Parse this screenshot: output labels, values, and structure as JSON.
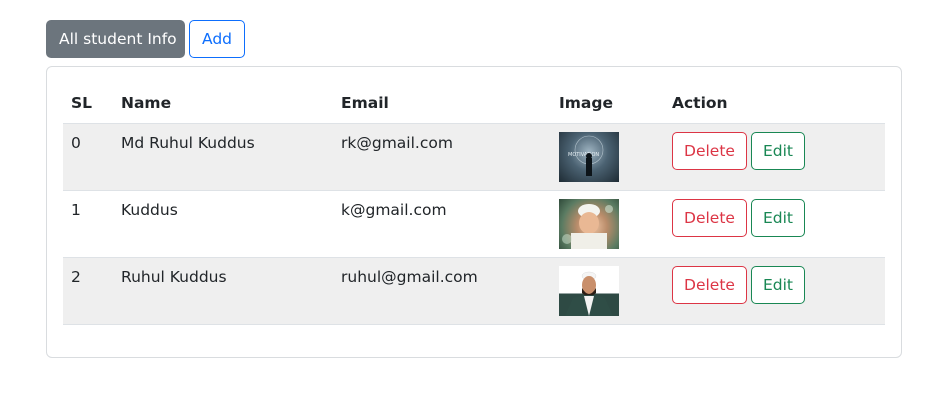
{
  "nav": {
    "all_label": "All student Info",
    "add_label": "Add"
  },
  "table": {
    "headers": {
      "sl": "SL",
      "name": "Name",
      "email": "Email",
      "image": "Image",
      "action": "Action"
    },
    "rows": [
      {
        "sl": "0",
        "name": "Md Ruhul Kuddus",
        "email": "rk@gmail.com",
        "image": "photo-person-silhouette",
        "delete_label": "Delete",
        "edit_label": "Edit"
      },
      {
        "sl": "1",
        "name": "Kuddus",
        "email": "k@gmail.com",
        "image": "photo-child-praying",
        "delete_label": "Delete",
        "edit_label": "Edit"
      },
      {
        "sl": "2",
        "name": "Ruhul Kuddus",
        "email": "ruhul@gmail.com",
        "image": "photo-man-portrait",
        "delete_label": "Delete",
        "edit_label": "Edit"
      }
    ]
  },
  "colors": {
    "active_tab_bg": "#6c757d",
    "add_blue": "#0d6efd",
    "delete_red": "#dc3545",
    "edit_green": "#198754",
    "stripe": "#efefef"
  }
}
